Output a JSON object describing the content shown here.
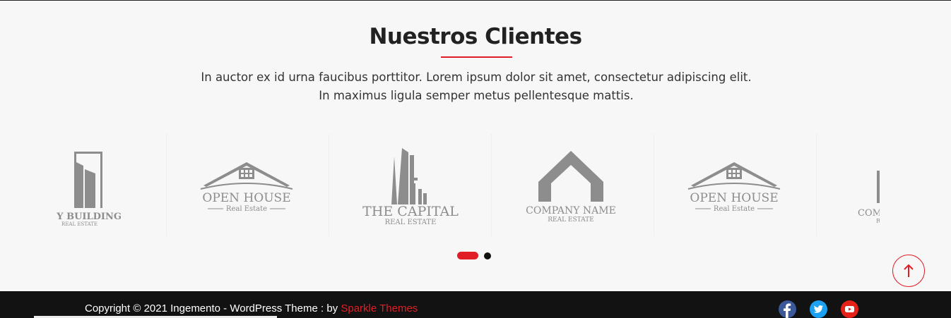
{
  "section": {
    "title": "Nuestros Clientes",
    "description": "In auctor ex id urna faucibus porttitor. Lorem ipsum dolor sit amet, consectetur adipiscing elit. In maximus ligula semper metus pellentesque mattis."
  },
  "clients": [
    {
      "name": "Y BUILDING",
      "sub": "REAL ESTATE",
      "icon": "building-logo-icon"
    },
    {
      "name": "OPEN HOUSE",
      "sub": "Real Estate",
      "icon": "house-roof-logo-icon"
    },
    {
      "name": "THE CAPITAL",
      "sub": "REAL ESTATE",
      "icon": "skyscraper-logo-icon"
    },
    {
      "name": "COMPANY NAME",
      "sub": "REAL ESTATE",
      "icon": "roof-chevron-logo-icon"
    },
    {
      "name": "OPEN HOUSE",
      "sub": "Real Estate",
      "icon": "house-roof-logo-icon"
    },
    {
      "name": "COM",
      "sub": "R",
      "icon": "tower-logo-icon"
    }
  ],
  "carousel": {
    "active_page": 1,
    "page_count": 2
  },
  "footer": {
    "copyright_prefix": "Copyright © 2021 Ingemento - WordPress Theme : by ",
    "credit_link": "Sparkle Themes",
    "social": [
      "facebook-icon",
      "twitter-icon",
      "youtube-icon"
    ]
  },
  "colors": {
    "accent": "#e11e26",
    "footer_bg": "#121212",
    "page_bg": "#f7f7f7",
    "logo_gray": "#8d8d8d"
  }
}
